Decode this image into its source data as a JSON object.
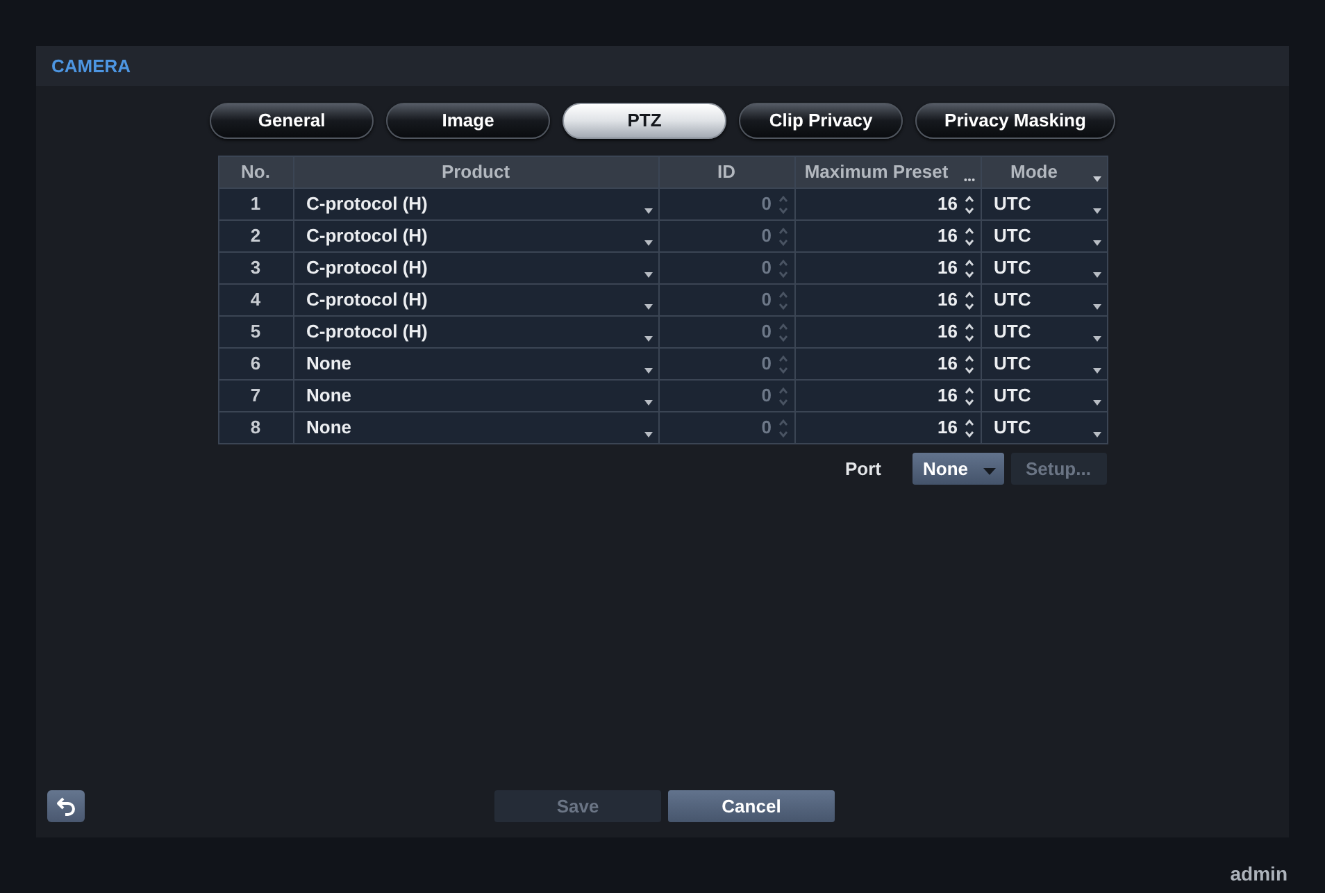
{
  "window": {
    "title": "CAMERA"
  },
  "tabs": [
    {
      "label": "General",
      "selected": false
    },
    {
      "label": "Image",
      "selected": false
    },
    {
      "label": "PTZ",
      "selected": true
    },
    {
      "label": "Clip Privacy",
      "selected": false
    },
    {
      "label": "Privacy Masking",
      "selected": false
    }
  ],
  "table": {
    "columns": [
      {
        "label": "No.",
        "kind": "plain"
      },
      {
        "label": "Product",
        "kind": "plain"
      },
      {
        "label": "ID",
        "kind": "plain"
      },
      {
        "label": "Maximum Preset",
        "kind": "more"
      },
      {
        "label": "Mode",
        "kind": "dropdown"
      }
    ],
    "rows": [
      {
        "no": "1",
        "product": "C-protocol (H)",
        "id": {
          "value": "0",
          "disabled": true
        },
        "maximum_preset": {
          "value": "16",
          "disabled": false
        },
        "mode": "UTC"
      },
      {
        "no": "2",
        "product": "C-protocol (H)",
        "id": {
          "value": "0",
          "disabled": true
        },
        "maximum_preset": {
          "value": "16",
          "disabled": false
        },
        "mode": "UTC"
      },
      {
        "no": "3",
        "product": "C-protocol (H)",
        "id": {
          "value": "0",
          "disabled": true
        },
        "maximum_preset": {
          "value": "16",
          "disabled": false
        },
        "mode": "UTC"
      },
      {
        "no": "4",
        "product": "C-protocol (H)",
        "id": {
          "value": "0",
          "disabled": true
        },
        "maximum_preset": {
          "value": "16",
          "disabled": false
        },
        "mode": "UTC"
      },
      {
        "no": "5",
        "product": "C-protocol (H)",
        "id": {
          "value": "0",
          "disabled": true
        },
        "maximum_preset": {
          "value": "16",
          "disabled": false
        },
        "mode": "UTC"
      },
      {
        "no": "6",
        "product": "None",
        "id": {
          "value": "0",
          "disabled": true
        },
        "maximum_preset": {
          "value": "16",
          "disabled": false
        },
        "mode": "UTC"
      },
      {
        "no": "7",
        "product": "None",
        "id": {
          "value": "0",
          "disabled": true
        },
        "maximum_preset": {
          "value": "16",
          "disabled": false
        },
        "mode": "UTC"
      },
      {
        "no": "8",
        "product": "None",
        "id": {
          "value": "0",
          "disabled": true
        },
        "maximum_preset": {
          "value": "16",
          "disabled": false
        },
        "mode": "UTC"
      }
    ]
  },
  "port": {
    "label": "Port",
    "value": "None",
    "setup_button": {
      "label": "Setup...",
      "disabled": true
    }
  },
  "footer": {
    "buttons": [
      {
        "label": "Save",
        "disabled": true
      },
      {
        "label": "Cancel",
        "disabled": false
      }
    ]
  },
  "status_bar": {
    "user": "admin"
  }
}
